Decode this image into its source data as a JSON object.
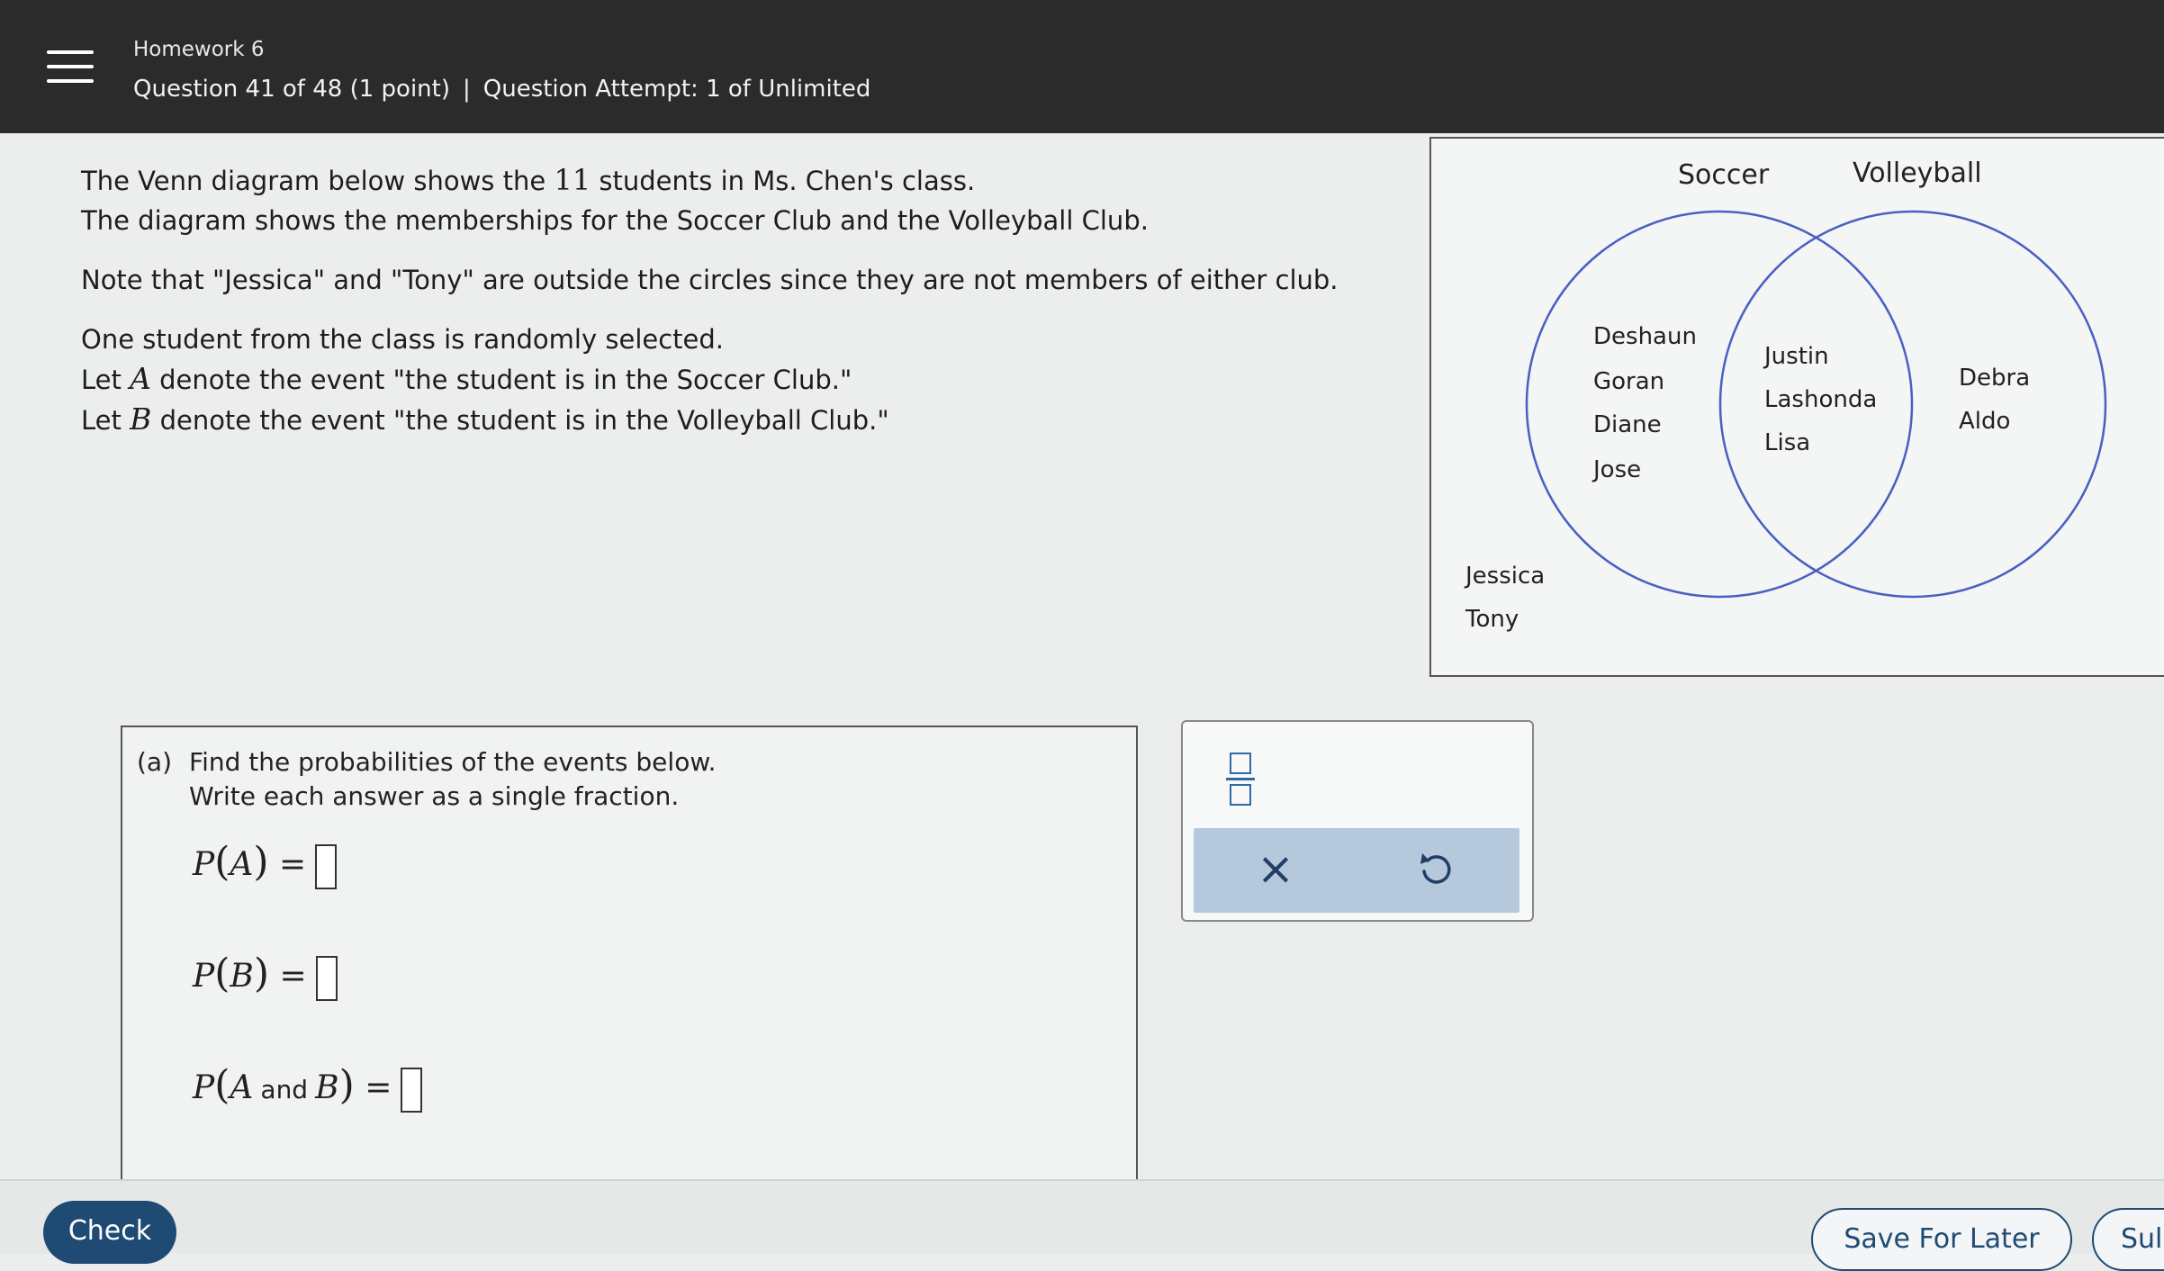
{
  "header": {
    "homework_title": "Homework 6",
    "question_progress": "Question 41 of 48 (1 point)",
    "separator": "|",
    "attempt": "Question Attempt: 1 of Unlimited"
  },
  "stem": {
    "line1_pre": "The Venn diagram below shows the",
    "line1_num": "11",
    "line1_post": "students in Ms. Chen's class.",
    "line2": "The diagram shows the memberships for the Soccer Club and the Volleyball Club.",
    "note": "Note that \"Jessica\" and \"Tony\" are outside the circles since they are not members of either club.",
    "select": "One student from the class is randomly selected.",
    "let_a_pre": "Let",
    "let_a_var": "A",
    "let_a_post": "denote the event \"the student is in the Soccer Club.\"",
    "let_b_pre": "Let",
    "let_b_var": "B",
    "let_b_post": "denote the event \"the student is in the Volleyball Club.\""
  },
  "venn": {
    "left_label": "Soccer",
    "right_label": "Volleyball",
    "left_only": [
      "Deshaun",
      "Goran",
      "Diane",
      "Jose"
    ],
    "both": [
      "Justin",
      "Lashonda",
      "Lisa"
    ],
    "right_only": [
      "Debra",
      "Aldo"
    ],
    "outside": [
      "Jessica",
      "Tony"
    ],
    "circle_color": "#4a5fc1"
  },
  "part_a": {
    "tag": "(a)",
    "instruction1": "Find the probabilities of the events below.",
    "instruction2": "Write each answer as a single fraction.",
    "p": "P",
    "open": "(",
    "close": ")",
    "equals": "=",
    "var_a": "A",
    "var_b": "B",
    "and_word": "and"
  },
  "tools": {
    "fraction_icon": "fraction-template-icon",
    "clear_symbol": "×",
    "undo_icon": "undo-icon"
  },
  "footer": {
    "check_label": "Check",
    "save_label": "Save For Later",
    "submit_label": "Sul"
  }
}
